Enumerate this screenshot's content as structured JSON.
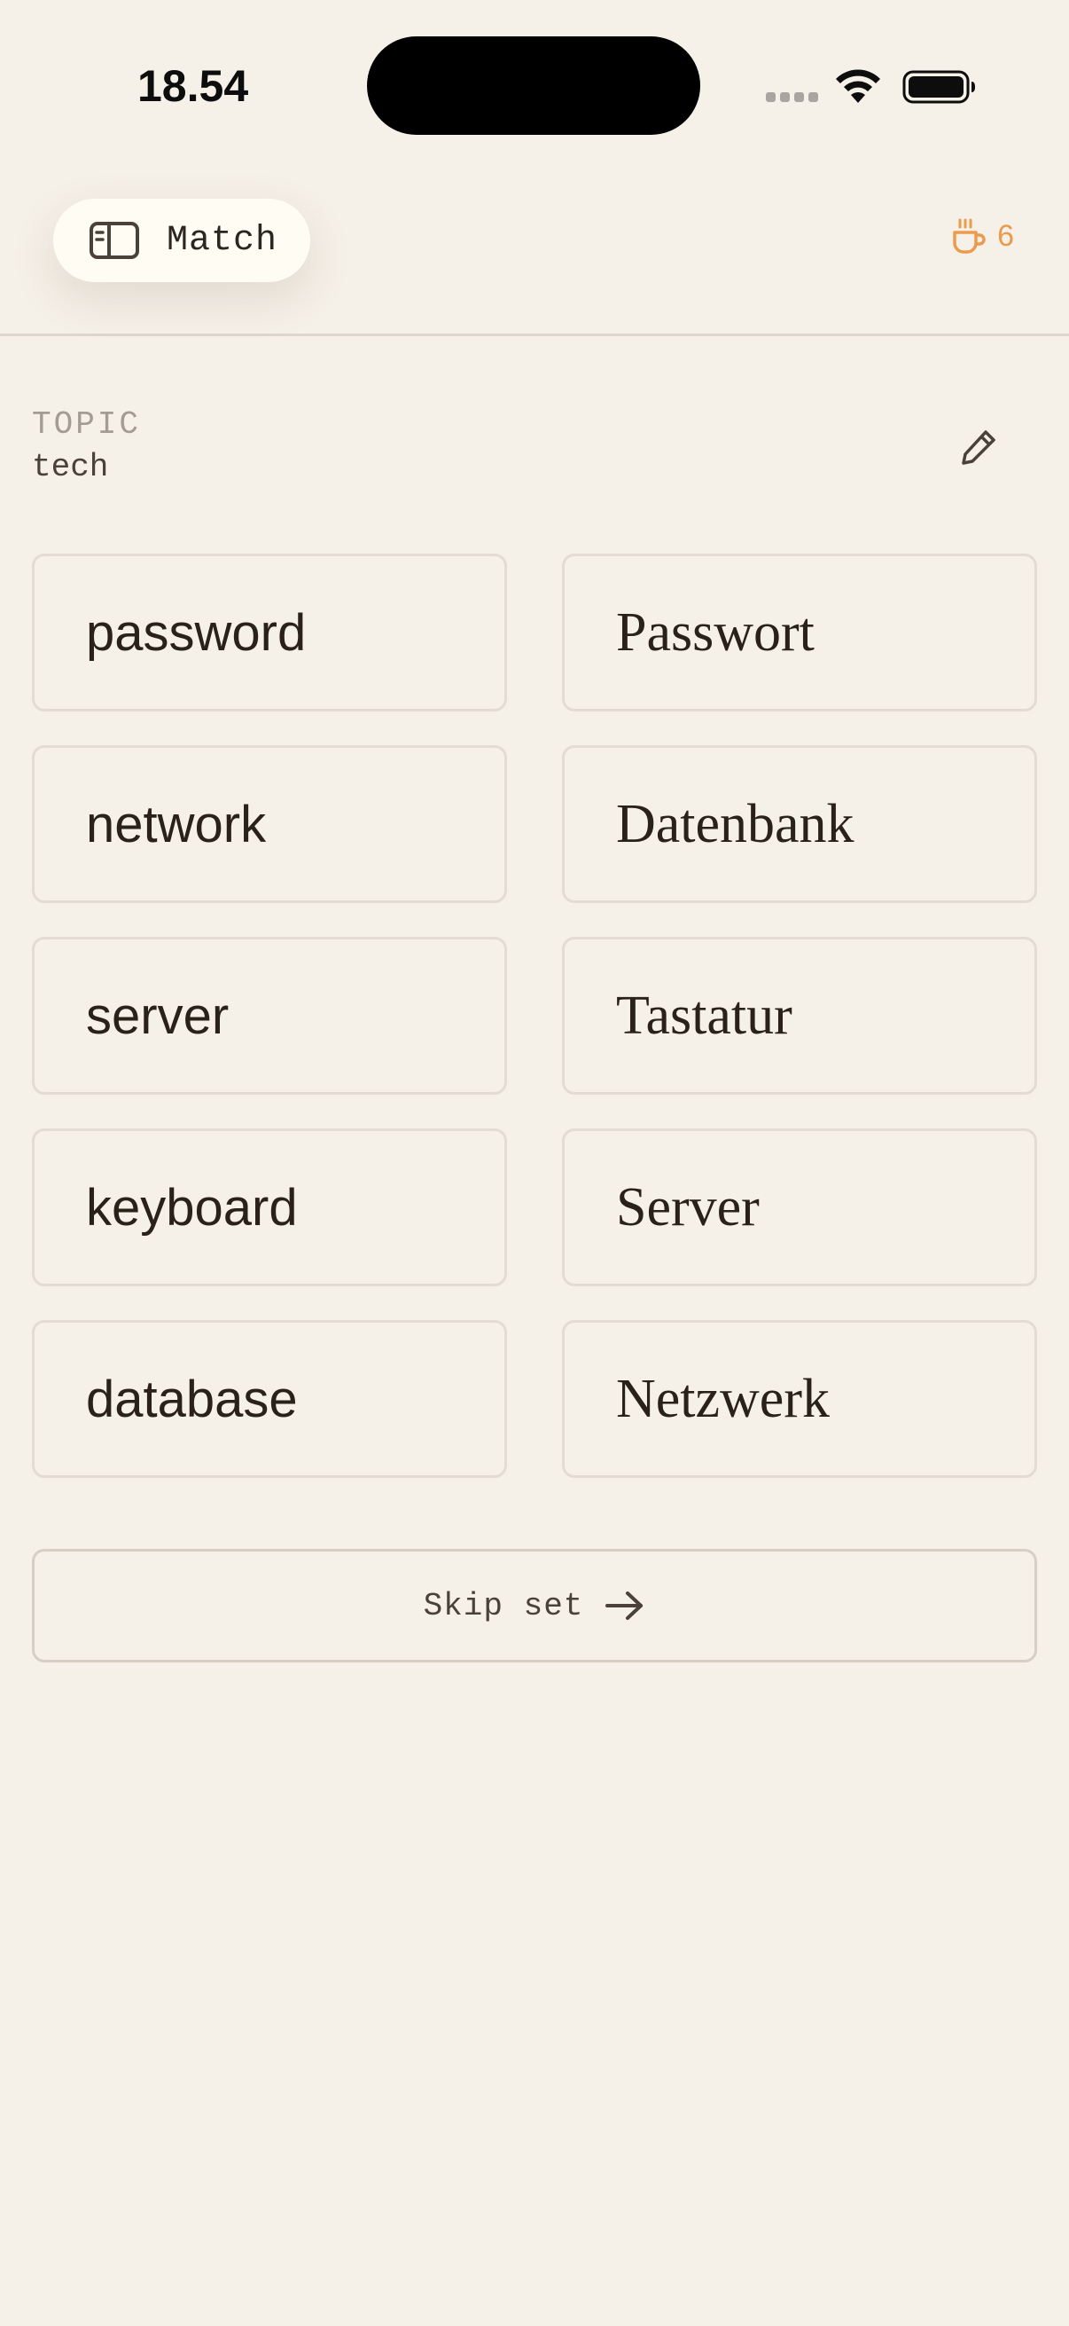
{
  "status_bar": {
    "time": "18.54"
  },
  "header": {
    "mode_label": "Match",
    "streak_count": "6",
    "accent_color": "#ec9a4c"
  },
  "topic": {
    "label": "TOPIC",
    "value": "tech"
  },
  "pairs": {
    "english": [
      "password",
      "network",
      "server",
      "keyboard",
      "database"
    ],
    "german": [
      "Passwort",
      "Datenbank",
      "Tastatur",
      "Server",
      "Netzwerk"
    ]
  },
  "skip": {
    "label": "Skip set"
  },
  "icons": {
    "sidebar": "sidebar-icon",
    "streak": "coffee-cup-icon",
    "edit": "pencil-icon",
    "skip": "arrow-right-icon"
  }
}
